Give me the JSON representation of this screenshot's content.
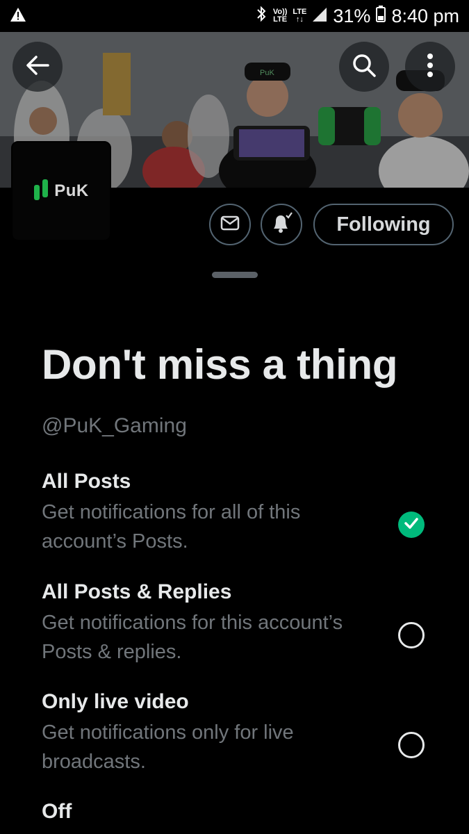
{
  "status_bar": {
    "left_icon": "warning-icon",
    "bluetooth_icon": "bluetooth-icon",
    "volte_top": "Vo))",
    "volte_bottom": "LTE",
    "lte_label": "LTE",
    "signal_icon": "signal-icon",
    "battery": "31%",
    "battery_icon": "battery-icon",
    "time": "8:40 pm"
  },
  "header": {
    "back_icon": "back-arrow-icon",
    "search_icon": "search-icon",
    "more_icon": "more-vertical-icon",
    "banner_cap_text": "PuK"
  },
  "profile": {
    "avatar_text": "PuK",
    "message_icon": "envelope-icon",
    "bell_icon": "bell-check-icon",
    "following_label": "Following"
  },
  "sheet": {
    "title": "Don't miss a thing",
    "handle": "@PuK_Gaming",
    "options": [
      {
        "title": "All Posts",
        "desc": "Get notifications for all of this account’s Posts.",
        "selected": true
      },
      {
        "title": "All Posts & Replies",
        "desc": "Get notifications for this account’s Posts & replies.",
        "selected": false
      },
      {
        "title": "Only live video",
        "desc": "Get notifications only for live broadcasts.",
        "selected": false
      },
      {
        "title": "Off",
        "desc": "",
        "selected": false
      }
    ]
  },
  "colors": {
    "background": "#000000",
    "primary_text": "#e7e9ea",
    "secondary_text": "#71767b",
    "selected": "#00ba7c",
    "border": "#536471",
    "brand_green": "#1fb24a"
  }
}
